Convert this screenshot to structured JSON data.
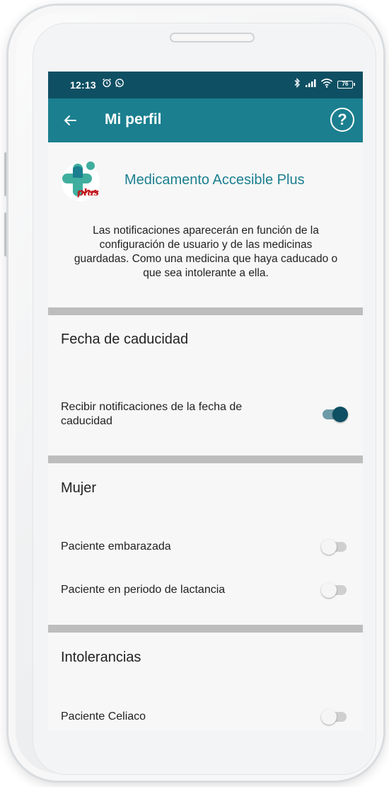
{
  "status_bar": {
    "time": "12:13",
    "left_icons": [
      "alarm-icon",
      "whatsapp-icon"
    ],
    "right_icons": [
      "bluetooth-icon",
      "signal-icon",
      "wifi-icon",
      "battery-icon"
    ],
    "battery": "76"
  },
  "app_bar": {
    "back_icon": "arrow-left-icon",
    "title": "Mi perfil",
    "help_label": "?"
  },
  "header": {
    "app_name": "Medicamento Accesible Plus",
    "logo_text": "plus",
    "intro": "Las notificaciones aparecerán en función de la configuración de usuario y de las medicinas guardadas. Como una medicina que haya caducado o que sea intolerante a ella."
  },
  "sections": [
    {
      "title": "Fecha de caducidad",
      "settings": [
        {
          "label": "Recibir notificaciones de la fecha de caducidad",
          "enabled": true
        }
      ]
    },
    {
      "title": "Mujer",
      "settings": [
        {
          "label": "Paciente embarazada",
          "enabled": false
        },
        {
          "label": "Paciente en periodo de lactancia",
          "enabled": false
        }
      ]
    },
    {
      "title": "Intolerancias",
      "settings": [
        {
          "label": "Paciente Celiaco",
          "enabled": false
        }
      ]
    }
  ],
  "colors": {
    "status_bar": "#0e4f63",
    "app_bar": "#1b7f8f",
    "accent": "#1b7f8f",
    "toggle_on": "#0e4f63",
    "divider": "#bdbdbd"
  }
}
